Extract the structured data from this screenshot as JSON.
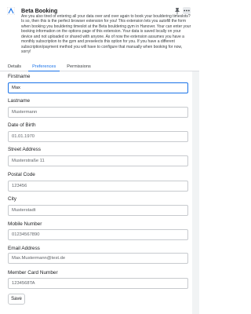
{
  "header": {
    "title": "Beta Booking",
    "description": "Are you also tired of entering all your data over and over again to book your bouldering timeslots? Is so, then this is the perfect browser extension for you! This extension lets you autofill the form when booking you bouldering timeslot at the Beta bouldering gym in Hanover. Your can enter your booking information on the options page of this extension. Your data is saved locally on your device and not uploaded or shared with anyone. As of now the extension assumes you have a monthly subscription to the gym and preselects this option for you. If you have a different subscription/payment method you will have to configure that manually when booking for now, sorry!",
    "icon": "climbing-app-icon",
    "pin_icon": "pin-icon",
    "menu_icon": "more-horizontal-icon"
  },
  "tabs": [
    {
      "label": "Details",
      "active": false
    },
    {
      "label": "Preferences",
      "active": true
    },
    {
      "label": "Permissions",
      "active": false
    }
  ],
  "form": {
    "firstname": {
      "label": "Firstname",
      "value": "Max"
    },
    "lastname": {
      "label": "Lastname",
      "value": "Mustermann"
    },
    "dob": {
      "label": "Date of Birth",
      "value": "01.01.1970"
    },
    "street": {
      "label": "Street Address",
      "value": "Musterstraße 11"
    },
    "postal": {
      "label": "Postal Code",
      "value": "123456"
    },
    "city": {
      "label": "City",
      "value": "Musterstadt"
    },
    "mobile": {
      "label": "Mobile Number",
      "value": "01234567890"
    },
    "email": {
      "label": "Email Address",
      "value": "Max.Mustermann@test.de"
    },
    "member": {
      "label": "Member Card Number",
      "value": "1234568TA"
    },
    "save_label": "Save"
  },
  "colors": {
    "accent": "#1a73e8",
    "border": "#c7cace"
  }
}
